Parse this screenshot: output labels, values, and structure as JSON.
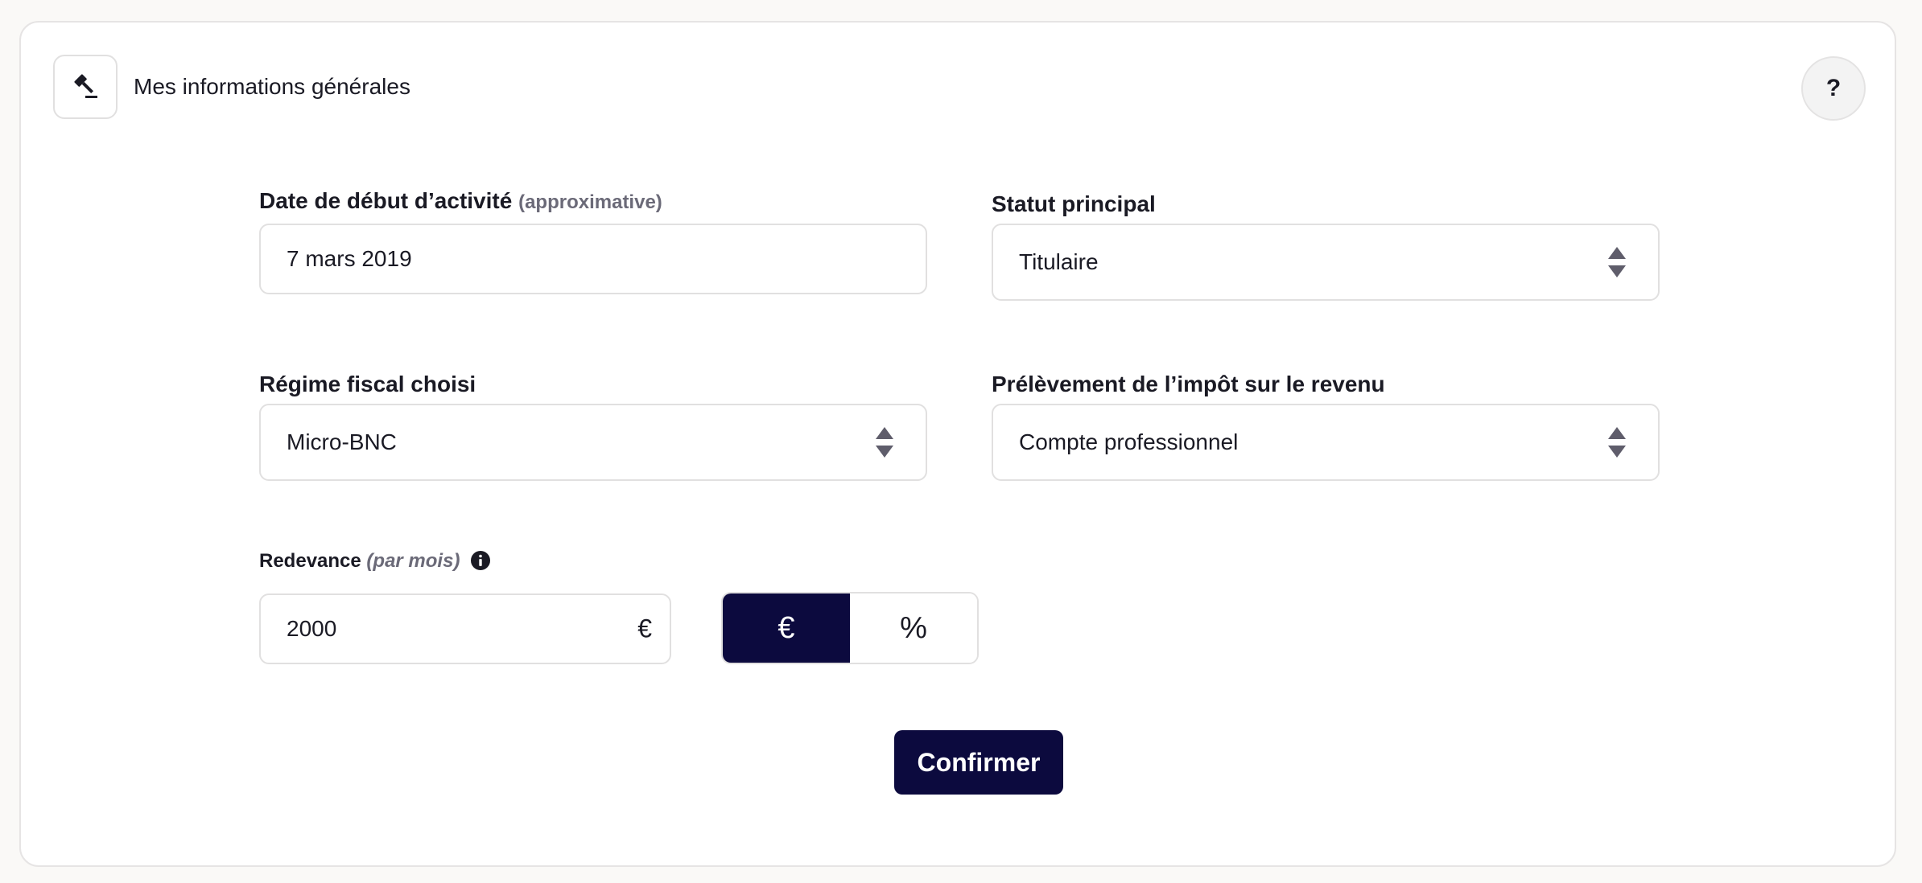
{
  "header": {
    "title": "Mes informations générales",
    "icon": "gavel-icon",
    "help_label": "?"
  },
  "fields": {
    "start_date": {
      "label": "Date de début d’activité",
      "hint": "(approximative)",
      "value": "7 mars 2019"
    },
    "status": {
      "label": "Statut principal",
      "value": "Titulaire"
    },
    "tax_regime": {
      "label": "Régime fiscal choisi",
      "value": "Micro-BNC"
    },
    "tax_withholding": {
      "label": "Prélèvement de l’impôt sur le revenu",
      "value": "Compte professionnel"
    },
    "royalty": {
      "label": "Redevance",
      "hint": "(par mois)",
      "value": "2000",
      "suffix": "€",
      "info_icon": "info-icon"
    }
  },
  "unit_toggle": {
    "options": [
      "€",
      "%"
    ],
    "selected": "€"
  },
  "actions": {
    "confirm_label": "Confirmer"
  },
  "colors": {
    "primary": "#0c0a3e",
    "border": "#e1e0e0",
    "muted": "#6b6a78"
  }
}
